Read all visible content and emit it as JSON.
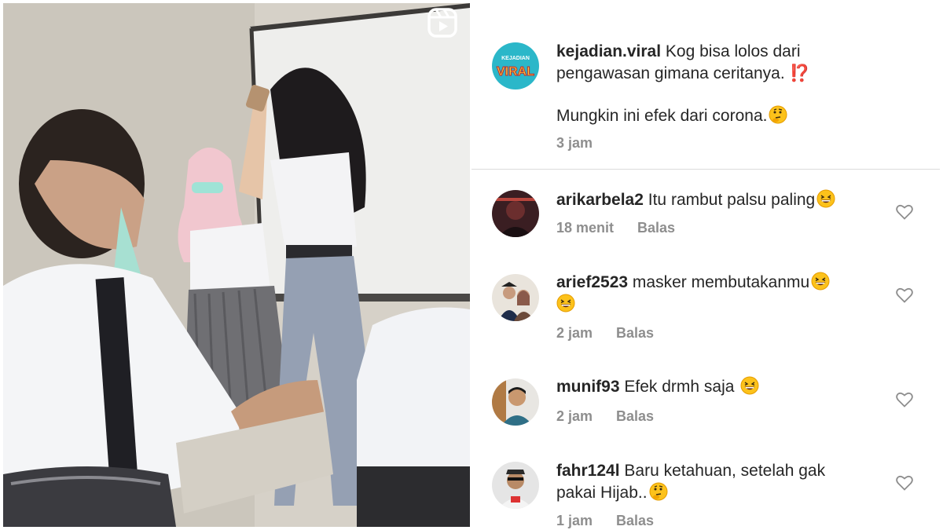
{
  "media": {
    "badge_icon": "reels-icon",
    "colors": {
      "wall": "#d8d3ca",
      "board": "#eeeeec",
      "shirt": "#f2f3f5"
    }
  },
  "caption": {
    "username": "kejadian.viral",
    "text_line1": "Kog bisa lolos dari",
    "text_line2": "pengawasan gimana ceritanya. ⁉️",
    "text_line3": "Mungkin ini efek dari corona.",
    "emoji": "thinking-face",
    "time": "3 jam",
    "avatar_label_small": "KEJADIAN",
    "avatar_label_big": "VIRAL"
  },
  "comments": [
    {
      "username": "arikarbela2",
      "text": "Itu rambut palsu paling",
      "emoji": "grinning-squinting-face",
      "time": "18 menit",
      "reply": "Balas"
    },
    {
      "username": "arief2523",
      "text": "masker membutakanmu",
      "emoji": "grinning-squinting-face",
      "time": "2 jam",
      "reply": "Balas"
    },
    {
      "username": "munif93",
      "text": "Efek drmh saja",
      "emoji": "grinning-squinting-face",
      "time": "2 jam",
      "reply": "Balas"
    },
    {
      "username": "fahr124l",
      "text": "Baru ketahuan, setelah gak",
      "text_line2": "pakai Hijab..",
      "emoji": "thinking-face",
      "time": "1 jam",
      "reply": "Balas"
    }
  ],
  "colors": {
    "accent_text": "#262626",
    "meta_text": "#8e8e8e",
    "divider": "#dbdbdb"
  }
}
